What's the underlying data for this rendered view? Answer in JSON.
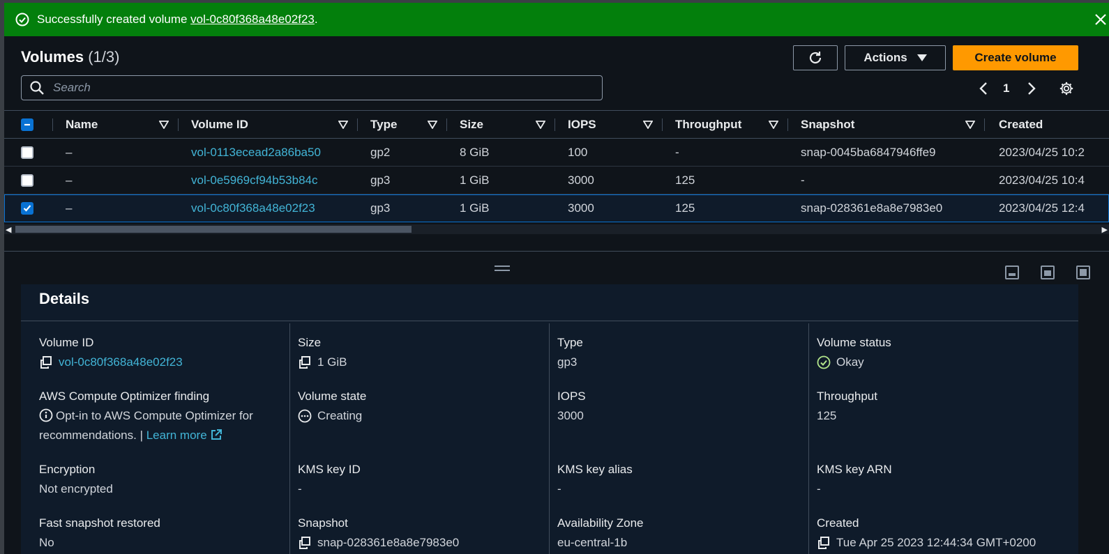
{
  "flash": {
    "prefix": "Successfully created volume ",
    "volume_link": "vol-0c80f368a48e02f23",
    "suffix": "."
  },
  "header": {
    "title": "Volumes",
    "count": "(1/3)",
    "actions_label": "Actions",
    "create_label": "Create volume",
    "search_placeholder": "Search",
    "page": "1"
  },
  "columns": [
    "Name",
    "Volume ID",
    "Type",
    "Size",
    "IOPS",
    "Throughput",
    "Snapshot",
    "Created"
  ],
  "rows": [
    {
      "name": "–",
      "volume_id": "vol-0113ecead2a86ba50",
      "type": "gp2",
      "size": "8 GiB",
      "iops": "100",
      "throughput": "-",
      "snapshot": "snap-0045ba6847946ffe9",
      "created": "2023/04/25 10:2",
      "checked": false
    },
    {
      "name": "–",
      "volume_id": "vol-0e5969cf94b53b84c",
      "type": "gp3",
      "size": "1 GiB",
      "iops": "3000",
      "throughput": "125",
      "snapshot": "-",
      "created": "2023/04/25 10:4",
      "checked": false
    },
    {
      "name": "–",
      "volume_id": "vol-0c80f368a48e02f23",
      "type": "gp3",
      "size": "1 GiB",
      "iops": "3000",
      "throughput": "125",
      "snapshot": "snap-028361e8a8e7983e0",
      "created": "2023/04/25 12:4",
      "checked": true
    }
  ],
  "details": {
    "title": "Details",
    "volume_id_label": "Volume ID",
    "volume_id": "vol-0c80f368a48e02f23",
    "size_label": "Size",
    "size": "1 GiB",
    "type_label": "Type",
    "type": "gp3",
    "status_label": "Volume status",
    "status": "Okay",
    "optimizer_label": "AWS Compute Optimizer finding",
    "optimizer_text": "Opt-in to AWS Compute Optimizer for recommendations. |",
    "learn_more": "Learn more",
    "state_label": "Volume state",
    "state": "Creating",
    "iops_label": "IOPS",
    "iops": "3000",
    "throughput_label": "Throughput",
    "throughput": "125",
    "encryption_label": "Encryption",
    "encryption": "Not encrypted",
    "kms_id_label": "KMS key ID",
    "kms_id": "-",
    "kms_alias_label": "KMS key alias",
    "kms_alias": "-",
    "kms_arn_label": "KMS key ARN",
    "kms_arn": "-",
    "fast_snapshot_label": "Fast snapshot restored",
    "fast_snapshot": "No",
    "snapshot_label": "Snapshot",
    "snapshot": "snap-028361e8a8e7983e0",
    "az_label": "Availability Zone",
    "az": "eu-central-1b",
    "created_label": "Created",
    "created": "Tue Apr 25 2023 12:44:34 GMT+0200"
  },
  "colors": {
    "flash_bg": "#037f0c",
    "primary_button": "#ff9900",
    "link": "#42b4d6",
    "status_ok": "#b3e68b"
  }
}
